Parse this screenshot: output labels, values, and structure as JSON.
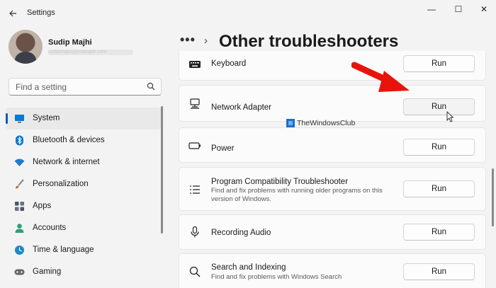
{
  "window": {
    "title": "Settings",
    "back_icon": "back-arrow-icon",
    "controls": {
      "minimize": "—",
      "maximize": "☐",
      "close": "✕"
    }
  },
  "profile": {
    "name": "Sudip Majhi",
    "email": "sudipmajhi@example.com"
  },
  "search": {
    "placeholder": "Find a setting",
    "icon": "search-icon"
  },
  "sidebar": {
    "items": [
      {
        "label": "System",
        "icon": "system-monitor-icon",
        "color": "#0078d4",
        "active": true
      },
      {
        "label": "Bluetooth & devices",
        "icon": "bluetooth-icon",
        "color": "#0078d4"
      },
      {
        "label": "Network & internet",
        "icon": "wifi-icon",
        "color": "#1e7bd0"
      },
      {
        "label": "Personalization",
        "icon": "brush-icon",
        "color": "#c46a2a"
      },
      {
        "label": "Apps",
        "icon": "apps-grid-icon",
        "color": "#4a5568"
      },
      {
        "label": "Accounts",
        "icon": "person-icon",
        "color": "#2f9e7a"
      },
      {
        "label": "Time & language",
        "icon": "globe-clock-icon",
        "color": "#1e88c8"
      },
      {
        "label": "Gaming",
        "icon": "gamepad-icon",
        "color": "#666666"
      }
    ]
  },
  "breadcrumb": {
    "more": "•••",
    "separator": "›",
    "title": "Other troubleshooters"
  },
  "troubleshooters": [
    {
      "title": "Keyboard",
      "icon": "keyboard-icon",
      "run": "Run"
    },
    {
      "title": "Network Adapter",
      "icon": "network-adapter-icon",
      "run": "Run"
    },
    {
      "title": "Power",
      "icon": "battery-icon",
      "run": "Run"
    },
    {
      "title": "Program Compatibility Troubleshooter",
      "description": "Find and fix problems with running older programs on this version of Windows.",
      "icon": "list-icon",
      "run": "Run"
    },
    {
      "title": "Recording Audio",
      "icon": "microphone-icon",
      "run": "Run"
    },
    {
      "title": "Search and Indexing",
      "description": "Find and fix problems with Windows Search",
      "icon": "search-icon",
      "run": "Run"
    }
  ],
  "watermark": {
    "text": "TheWindowsClub"
  },
  "accent": "#005fb8",
  "annotation_color": "#e8140c"
}
